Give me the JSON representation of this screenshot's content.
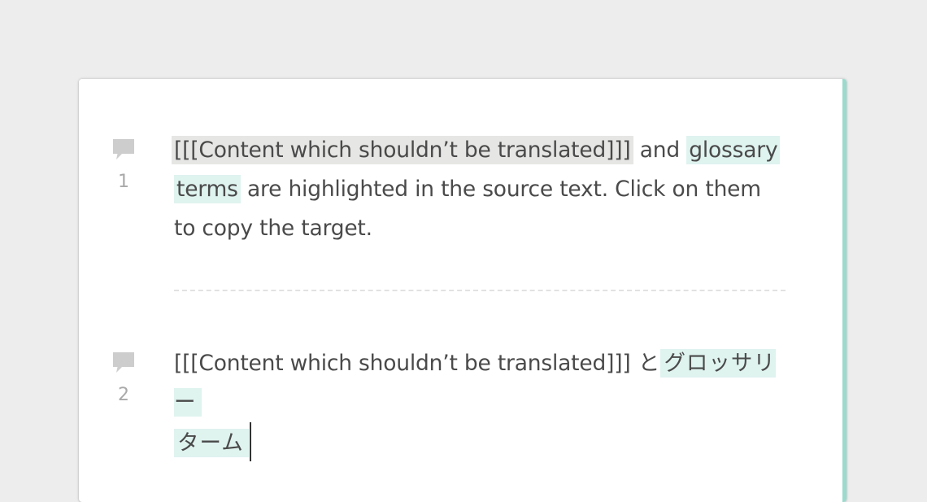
{
  "editor": {
    "accent_color": "#9adbcd",
    "glossary_highlight_color": "#dff3ef",
    "locked_highlight_color": "#e6e6e4",
    "segments": [
      {
        "number": "1",
        "comment_icon": "comment-icon",
        "source": {
          "locked": "[[[Content which shouldn’t be translated]]]",
          "after_locked": " and ",
          "glossary_1": "glossary",
          "glossary_2": "terms",
          "rest": " are highlighted in the source text. Click on them to copy the target."
        }
      },
      {
        "number": "2",
        "comment_icon": "comment-icon",
        "target": {
          "locked": "[[[Content which shouldn’t be translated]]]",
          "after_locked": " と",
          "glossary_1": "グロッサリー",
          "glossary_2": "ターム"
        }
      }
    ]
  }
}
